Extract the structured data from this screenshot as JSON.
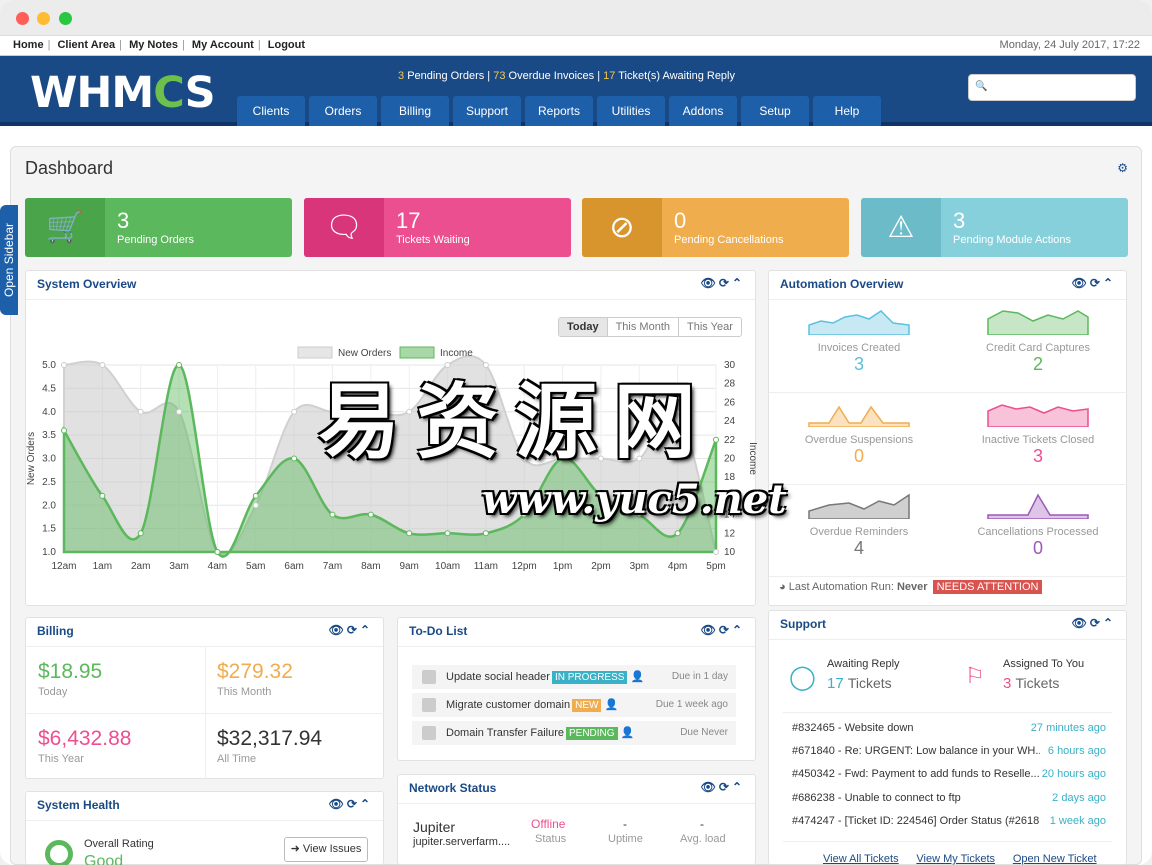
{
  "window": {
    "dot_colors": [
      "#fe5f57",
      "#febc2e",
      "#28c840"
    ]
  },
  "toplinks": [
    "Home",
    "Client Area",
    "My Notes",
    "My Account",
    "Logout"
  ],
  "date": "Monday, 24 July 2017, 17:22",
  "logo": {
    "prefix": "WHM",
    "gear": "C",
    "suffix": "S"
  },
  "stats": {
    "pending_orders": "3",
    "pending_orders_label": "Pending Orders",
    "overdue": "73",
    "overdue_label": "Overdue Invoices",
    "tickets": "17",
    "tickets_label": "Ticket(s) Awaiting Reply"
  },
  "nav": [
    "Clients",
    "Orders",
    "Billing",
    "Support",
    "Reports",
    "Utilities",
    "Addons",
    "Setup",
    "Help"
  ],
  "search": {
    "icon": "search-icon"
  },
  "sidebar_tab": "Open Sidebar",
  "page_title": "Dashboard",
  "tiles": [
    {
      "value": "3",
      "label": "Pending Orders",
      "icon": "cart-icon",
      "color": "#5cb85c",
      "icon_bg": "#4aa44a"
    },
    {
      "value": "17",
      "label": "Tickets Waiting",
      "icon": "chat-bubble-icon",
      "color": "#ec4f8f",
      "icon_bg": "#d9357a"
    },
    {
      "value": "0",
      "label": "Pending Cancellations",
      "icon": "ban-icon",
      "color": "#f0ad4e",
      "icon_bg": "#d8952e"
    },
    {
      "value": "3",
      "label": "Pending Module Actions",
      "icon": "warning-icon",
      "color": "#86d0db",
      "icon_bg": "#6bbcc8"
    }
  ],
  "system_overview": {
    "title": "System Overview",
    "ranges": [
      "Today",
      "This Month",
      "This Year"
    ],
    "legend": [
      "New Orders",
      "Income"
    ]
  },
  "chart_data": {
    "type": "area",
    "title": "",
    "x": [
      "12am",
      "1am",
      "2am",
      "3am",
      "4am",
      "5am",
      "6am",
      "7am",
      "8am",
      "9am",
      "10am",
      "11am",
      "12pm",
      "1pm",
      "2pm",
      "3pm",
      "4pm",
      "5pm"
    ],
    "xlabel": "",
    "ylabel": "New Orders",
    "y2label": "Income",
    "ylim": [
      1.0,
      5.0
    ],
    "y2lim": [
      10,
      30
    ],
    "yticks": [
      "5.0",
      "4.5",
      "4.0",
      "3.5",
      "3.0",
      "2.5",
      "2.0",
      "1.5",
      "1.0"
    ],
    "y2ticks": [
      "30",
      "28",
      "26",
      "24",
      "22",
      "20",
      "18",
      "16",
      "14",
      "12",
      "10"
    ],
    "series": [
      {
        "name": "New Orders",
        "axis": "left",
        "values": [
          5.0,
          5.0,
          4.0,
          4.0,
          1.0,
          2.0,
          4.0,
          4.0,
          4.0,
          4.0,
          5.0,
          5.0,
          3.0,
          3.0,
          3.0,
          3.0,
          4.0,
          1.0
        ]
      },
      {
        "name": "Income",
        "axis": "right",
        "values": [
          23,
          16,
          12,
          30,
          10,
          16,
          20,
          14,
          14,
          12,
          12,
          12,
          14,
          20,
          16,
          14,
          12,
          22
        ]
      }
    ],
    "grid": true,
    "legend_position": "top"
  },
  "automation": {
    "title": "Automation Overview",
    "items": [
      {
        "label": "Invoices Created",
        "value": "3",
        "color": "#5bc0de"
      },
      {
        "label": "Credit Card Captures",
        "value": "2",
        "color": "#5cb85c"
      },
      {
        "label": "Overdue Suspensions",
        "value": "0",
        "color": "#f0ad4e"
      },
      {
        "label": "Inactive Tickets Closed",
        "value": "3",
        "color": "#ec4f8f"
      },
      {
        "label": "Overdue Reminders",
        "value": "4",
        "color": "#777777"
      },
      {
        "label": "Cancellations Processed",
        "value": "0",
        "color": "#9b59b6"
      }
    ],
    "last_run_label": "Last Automation Run:",
    "last_run_value": "Never",
    "attention": "NEEDS ATTENTION"
  },
  "billing": {
    "title": "Billing",
    "cells": [
      {
        "value": "$18.95",
        "label": "Today",
        "color": "#5cb85c"
      },
      {
        "value": "$279.32",
        "label": "This Month",
        "color": "#f0ad4e"
      },
      {
        "value": "$6,432.88",
        "label": "This Year",
        "color": "#ec4f8f"
      },
      {
        "value": "$32,317.94",
        "label": "All Time",
        "color": "#333333"
      }
    ]
  },
  "todo": {
    "title": "To-Do List",
    "items": [
      {
        "text": "Update social header",
        "badge": "IN PROGRESS",
        "badge_color": "#3ab1c6",
        "due": "Due in 1 day"
      },
      {
        "text": "Migrate customer domain",
        "badge": "NEW",
        "badge_color": "#f0ad4e",
        "due": "Due 1 week ago"
      },
      {
        "text": "Domain Transfer Failure",
        "badge": "PENDING",
        "badge_color": "#5cb85c",
        "due": "Due Never"
      }
    ]
  },
  "network": {
    "title": "Network Status",
    "server": "Jupiter",
    "host": "jupiter.serverfarm....",
    "status": "Offline",
    "status_label": "Status",
    "uptime": "-",
    "uptime_label": "Uptime",
    "load": "-",
    "load_label": "Avg. load"
  },
  "system_health": {
    "title": "System Health",
    "rating_label": "Overall Rating",
    "rating": "Good",
    "button": "View Issues"
  },
  "support": {
    "title": "Support",
    "awaiting_label": "Awaiting Reply",
    "awaiting_count": "17",
    "awaiting_unit": "Tickets",
    "assigned_label": "Assigned To You",
    "assigned_count": "3",
    "assigned_unit": "Tickets",
    "tickets": [
      {
        "text": "#832465 - Website down",
        "ago": "27 minutes ago"
      },
      {
        "text": "#671840 - Re: URGENT: Low balance in your WH...",
        "ago": "6 hours ago"
      },
      {
        "text": "#450342 - Fwd: Payment to add funds to Reselle...",
        "ago": "20 hours ago"
      },
      {
        "text": "#686238 - Unable to connect to ftp",
        "ago": "2 days ago"
      },
      {
        "text": "#474247 - [Ticket ID: 224546] Order Status (#2618...",
        "ago": "1 week ago"
      }
    ],
    "links": [
      "View All Tickets",
      "View My Tickets",
      "Open New Ticket"
    ]
  },
  "watermark": {
    "cn": "易 资 源 网",
    "url": "www.yuc5.net"
  }
}
